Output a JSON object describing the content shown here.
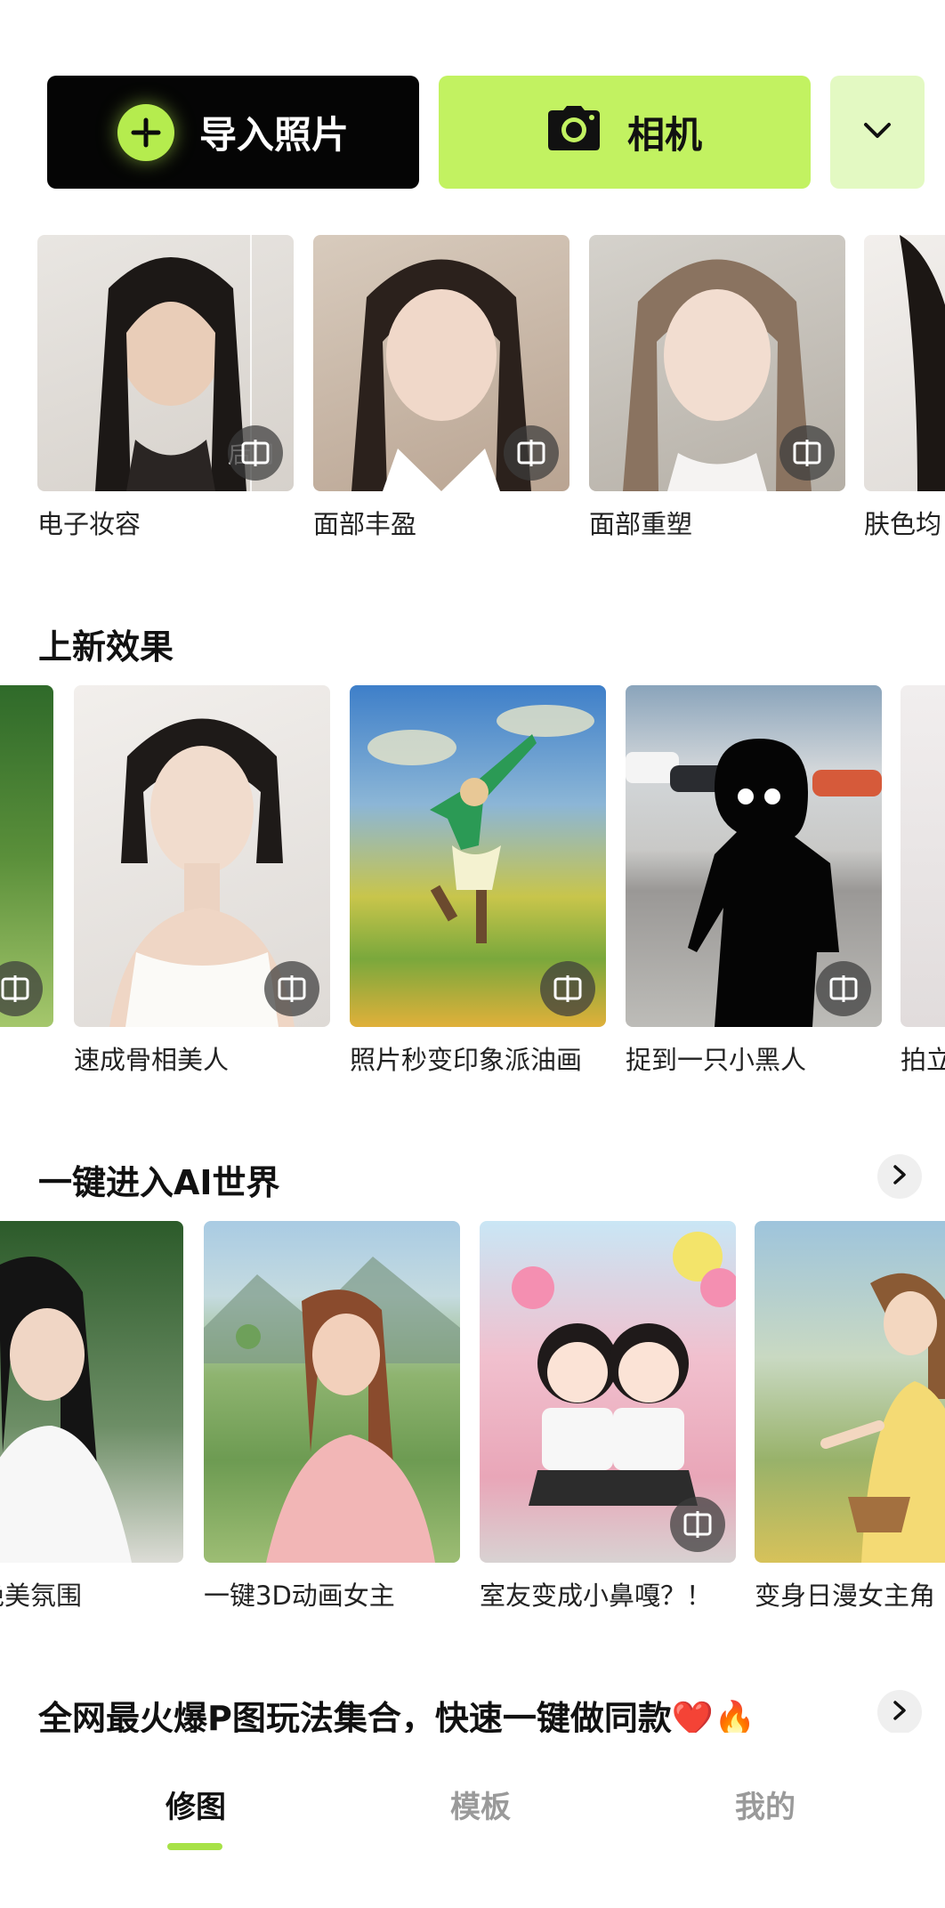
{
  "actions": {
    "import_label": "导入照片",
    "camera_label": "相机"
  },
  "row1": {
    "items": [
      {
        "label": "电子妆容",
        "overlay_text": "后门"
      },
      {
        "label": "面部丰盈"
      },
      {
        "label": "面部重塑"
      },
      {
        "label": "肤色均"
      }
    ]
  },
  "section_new": {
    "title": "上新效果",
    "items": [
      {
        "label": ""
      },
      {
        "label": "速成骨相美人"
      },
      {
        "label": "照片秒变印象派油画"
      },
      {
        "label": "捉到一只小黑人"
      },
      {
        "label": "拍立"
      }
    ]
  },
  "section_ai": {
    "title": "一键进入AI世界",
    "items": [
      {
        "label": "照的绝美氛围"
      },
      {
        "label": "一键3D动画女主"
      },
      {
        "label": "室友变成小鼻嘎？！"
      },
      {
        "label": "变身日漫女主角"
      }
    ]
  },
  "section_hot": {
    "title": "全网最火爆P图玩法集合，快速一键做同款❤️🔥"
  },
  "tabbar": {
    "tabs": [
      {
        "label": "修图",
        "active": true
      },
      {
        "label": "模板",
        "active": false
      },
      {
        "label": "我的",
        "active": false
      }
    ]
  },
  "colors": {
    "accent_green": "#c2f261",
    "accent_green_light": "#e3f9c2",
    "import_bg": "#050505",
    "tab_indicator": "#a7e247"
  },
  "icons": {
    "import": "plus-badge-icon",
    "camera": "camera-icon",
    "more": "chevron-down-icon",
    "compare": "compare-icon",
    "section_more": "chevron-right-icon"
  }
}
